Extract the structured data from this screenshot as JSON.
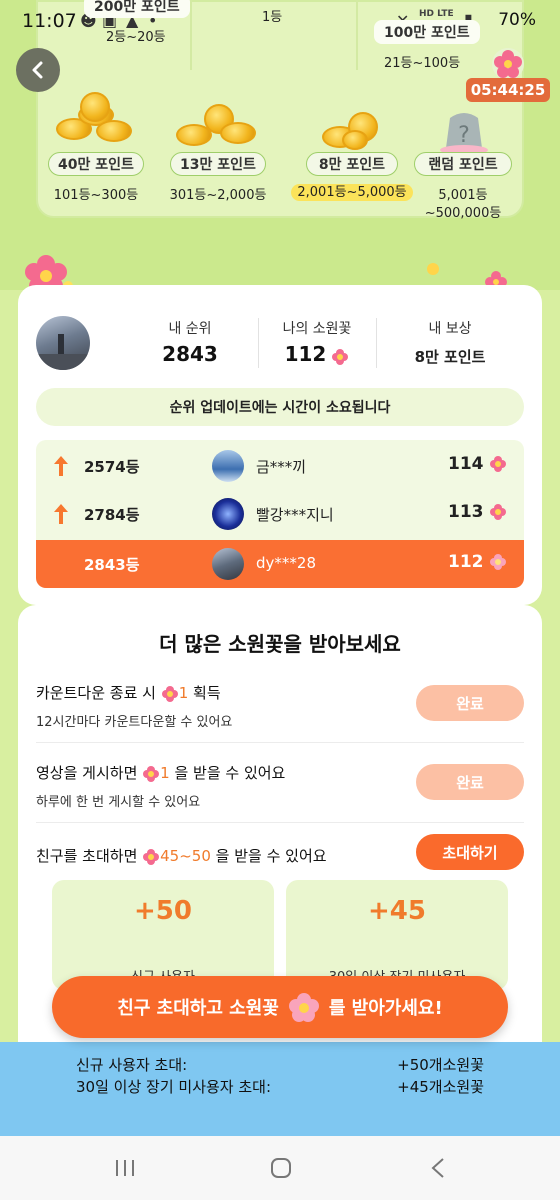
{
  "status_bar": {
    "time": "11:07",
    "battery": "70%",
    "network": "LTE",
    "hd": "HD"
  },
  "top_board": {
    "podium": [
      {
        "label": "200만 포인트",
        "range": "2등~20등"
      },
      {
        "label": "",
        "range": "1등"
      },
      {
        "label": "100만 포인트",
        "range": "21등~100등"
      }
    ],
    "timer": "05:44:25",
    "rewards": [
      {
        "label": "40만 포인트",
        "range": "101등~300등"
      },
      {
        "label": "13만 포인트",
        "range": "301등~2,000등"
      },
      {
        "label": "8만 포인트",
        "range": "2,001등~5,000등"
      },
      {
        "label": "랜덤 포인트",
        "range_line1": "5,001등",
        "range_line2": "~500,000등"
      }
    ]
  },
  "my_rank": {
    "rank_label": "내 순위",
    "rank_value": "2843",
    "flowers_label": "나의 소원꽃",
    "flowers_value": "112",
    "reward_label": "내 보상",
    "reward_value": "8만 포인트",
    "notice": "순위 업데이트에는 시간이 소요됩니다"
  },
  "ranking_rows": [
    {
      "rank": "2574등",
      "name": "금***끼",
      "score": "114",
      "arrow": true
    },
    {
      "rank": "2784등",
      "name": "빨강***지니",
      "score": "113",
      "arrow": true
    },
    {
      "rank": "2843등",
      "name": "dy***28",
      "score": "112",
      "arrow": false
    }
  ],
  "tasks": {
    "title": "더 많은 소원꽃을 받아보세요",
    "items": [
      {
        "title_pre": "카운트다운 종료 시 ",
        "amount": "1",
        "title_post": " 획득",
        "sub": "12시간마다 카운트다운할 수 있어요",
        "button": "완료"
      },
      {
        "title_pre": "영상을 게시하면 ",
        "amount": "1",
        "title_post": " 을 받을 수 있어요",
        "sub": "하루에 한 번 게시할 수 있어요",
        "button": "완료"
      },
      {
        "title_pre": "친구를 초대하면 ",
        "amount": "45~50",
        "title_post": " 을 받을 수 있어요",
        "button": "초대하기"
      }
    ],
    "bonuses": [
      {
        "value": "+50",
        "desc": "신규 사용자"
      },
      {
        "value": "+45",
        "desc": "30일 이상 장기 미사용자"
      }
    ]
  },
  "cta": {
    "pre": "친구 초대하고 소원꽃",
    "post": "를 받아가세요!"
  },
  "bottom_info": [
    {
      "label": "신규 사용자 초대:",
      "value": "+50개소원꽃"
    },
    {
      "label": "30일 이상 장기 미사용자 초대:",
      "value": "+45개소원꽃"
    }
  ],
  "colors": {
    "accent": "#fa6f33",
    "lime": "#cbe98d",
    "sky": "#7fc7f1"
  }
}
